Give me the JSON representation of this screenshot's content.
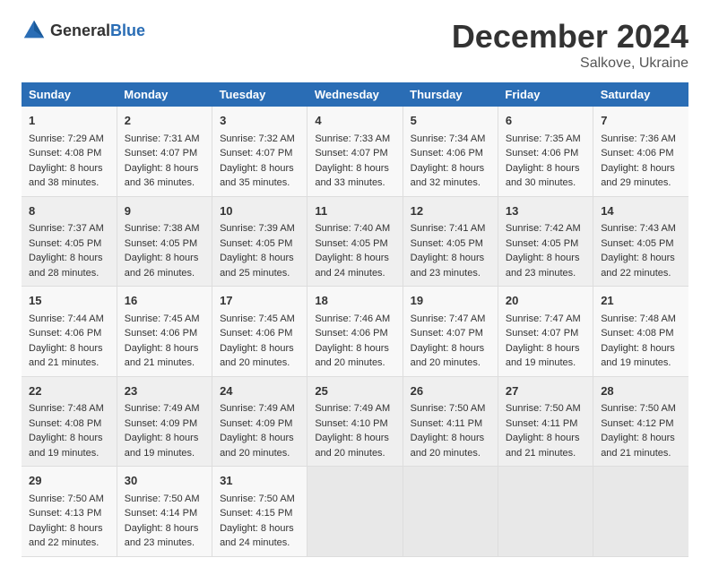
{
  "logo": {
    "general": "General",
    "blue": "Blue"
  },
  "header": {
    "month": "December 2024",
    "location": "Salkove, Ukraine"
  },
  "days_of_week": [
    "Sunday",
    "Monday",
    "Tuesday",
    "Wednesday",
    "Thursday",
    "Friday",
    "Saturday"
  ],
  "weeks": [
    [
      {
        "day": "1",
        "sunrise": "7:29 AM",
        "sunset": "4:08 PM",
        "daylight": "8 hours and 38 minutes."
      },
      {
        "day": "2",
        "sunrise": "7:31 AM",
        "sunset": "4:07 PM",
        "daylight": "8 hours and 36 minutes."
      },
      {
        "day": "3",
        "sunrise": "7:32 AM",
        "sunset": "4:07 PM",
        "daylight": "8 hours and 35 minutes."
      },
      {
        "day": "4",
        "sunrise": "7:33 AM",
        "sunset": "4:07 PM",
        "daylight": "8 hours and 33 minutes."
      },
      {
        "day": "5",
        "sunrise": "7:34 AM",
        "sunset": "4:06 PM",
        "daylight": "8 hours and 32 minutes."
      },
      {
        "day": "6",
        "sunrise": "7:35 AM",
        "sunset": "4:06 PM",
        "daylight": "8 hours and 30 minutes."
      },
      {
        "day": "7",
        "sunrise": "7:36 AM",
        "sunset": "4:06 PM",
        "daylight": "8 hours and 29 minutes."
      }
    ],
    [
      {
        "day": "8",
        "sunrise": "7:37 AM",
        "sunset": "4:05 PM",
        "daylight": "8 hours and 28 minutes."
      },
      {
        "day": "9",
        "sunrise": "7:38 AM",
        "sunset": "4:05 PM",
        "daylight": "8 hours and 26 minutes."
      },
      {
        "day": "10",
        "sunrise": "7:39 AM",
        "sunset": "4:05 PM",
        "daylight": "8 hours and 25 minutes."
      },
      {
        "day": "11",
        "sunrise": "7:40 AM",
        "sunset": "4:05 PM",
        "daylight": "8 hours and 24 minutes."
      },
      {
        "day": "12",
        "sunrise": "7:41 AM",
        "sunset": "4:05 PM",
        "daylight": "8 hours and 23 minutes."
      },
      {
        "day": "13",
        "sunrise": "7:42 AM",
        "sunset": "4:05 PM",
        "daylight": "8 hours and 23 minutes."
      },
      {
        "day": "14",
        "sunrise": "7:43 AM",
        "sunset": "4:05 PM",
        "daylight": "8 hours and 22 minutes."
      }
    ],
    [
      {
        "day": "15",
        "sunrise": "7:44 AM",
        "sunset": "4:06 PM",
        "daylight": "8 hours and 21 minutes."
      },
      {
        "day": "16",
        "sunrise": "7:45 AM",
        "sunset": "4:06 PM",
        "daylight": "8 hours and 21 minutes."
      },
      {
        "day": "17",
        "sunrise": "7:45 AM",
        "sunset": "4:06 PM",
        "daylight": "8 hours and 20 minutes."
      },
      {
        "day": "18",
        "sunrise": "7:46 AM",
        "sunset": "4:06 PM",
        "daylight": "8 hours and 20 minutes."
      },
      {
        "day": "19",
        "sunrise": "7:47 AM",
        "sunset": "4:07 PM",
        "daylight": "8 hours and 20 minutes."
      },
      {
        "day": "20",
        "sunrise": "7:47 AM",
        "sunset": "4:07 PM",
        "daylight": "8 hours and 19 minutes."
      },
      {
        "day": "21",
        "sunrise": "7:48 AM",
        "sunset": "4:08 PM",
        "daylight": "8 hours and 19 minutes."
      }
    ],
    [
      {
        "day": "22",
        "sunrise": "7:48 AM",
        "sunset": "4:08 PM",
        "daylight": "8 hours and 19 minutes."
      },
      {
        "day": "23",
        "sunrise": "7:49 AM",
        "sunset": "4:09 PM",
        "daylight": "8 hours and 19 minutes."
      },
      {
        "day": "24",
        "sunrise": "7:49 AM",
        "sunset": "4:09 PM",
        "daylight": "8 hours and 20 minutes."
      },
      {
        "day": "25",
        "sunrise": "7:49 AM",
        "sunset": "4:10 PM",
        "daylight": "8 hours and 20 minutes."
      },
      {
        "day": "26",
        "sunrise": "7:50 AM",
        "sunset": "4:11 PM",
        "daylight": "8 hours and 20 minutes."
      },
      {
        "day": "27",
        "sunrise": "7:50 AM",
        "sunset": "4:11 PM",
        "daylight": "8 hours and 21 minutes."
      },
      {
        "day": "28",
        "sunrise": "7:50 AM",
        "sunset": "4:12 PM",
        "daylight": "8 hours and 21 minutes."
      }
    ],
    [
      {
        "day": "29",
        "sunrise": "7:50 AM",
        "sunset": "4:13 PM",
        "daylight": "8 hours and 22 minutes."
      },
      {
        "day": "30",
        "sunrise": "7:50 AM",
        "sunset": "4:14 PM",
        "daylight": "8 hours and 23 minutes."
      },
      {
        "day": "31",
        "sunrise": "7:50 AM",
        "sunset": "4:15 PM",
        "daylight": "8 hours and 24 minutes."
      },
      null,
      null,
      null,
      null
    ]
  ],
  "labels": {
    "sunrise": "Sunrise:",
    "sunset": "Sunset:",
    "daylight": "Daylight:"
  }
}
